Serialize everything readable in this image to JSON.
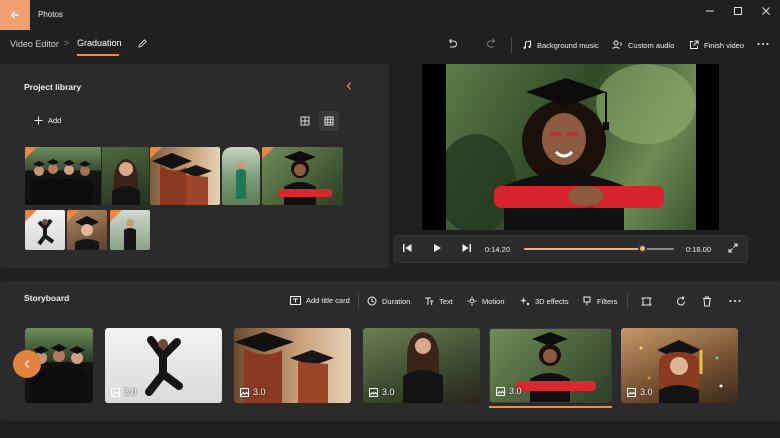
{
  "app": {
    "title": "Photos"
  },
  "breadcrumb": {
    "root": "Video Editor",
    "separator": ">",
    "current": "Graduation"
  },
  "toolbar": {
    "background_music": "Background music",
    "custom_audio": "Custom audio",
    "finish_video": "Finish video"
  },
  "library": {
    "title": "Project library",
    "add_label": "Add"
  },
  "player": {
    "current_time": "0:14.20",
    "total_time": "0:18.00",
    "progress": 0.79
  },
  "storyboard": {
    "title": "Storyboard",
    "add_title_card": "Add title card",
    "duration": "Duration",
    "text": "Text",
    "motion": "Motion",
    "effects_3d": "3D effects",
    "filters": "Filters",
    "clips": [
      {
        "duration": ""
      },
      {
        "duration": "3.0"
      },
      {
        "duration": "3.0"
      },
      {
        "duration": "3.0"
      },
      {
        "duration": "3.0"
      },
      {
        "duration": "3.0"
      }
    ]
  },
  "colors": {
    "accent": "#f08c4a",
    "background": "#202020",
    "panel": "#2b2b2b"
  }
}
